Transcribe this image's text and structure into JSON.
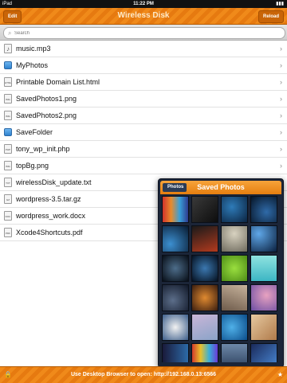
{
  "status_bar": {
    "carrier": "iPad",
    "time": "11:22 PM",
    "battery": "■■■"
  },
  "toolbar": {
    "title": "Wireless Disk",
    "edit_label": "Edit",
    "reload_label": "Reload"
  },
  "search": {
    "placeholder": "Search",
    "icon": "search-icon"
  },
  "files": [
    {
      "name": "music.mp3",
      "type": "audio",
      "badge": "♪"
    },
    {
      "name": "MyPhotos",
      "type": "folder",
      "badge": ""
    },
    {
      "name": "Printable Domain List.html",
      "type": "file",
      "badge": "HTML"
    },
    {
      "name": "SavedPhotos1.png",
      "type": "file",
      "badge": "IMG"
    },
    {
      "name": "SavedPhotos2.png",
      "type": "file",
      "badge": "IMG"
    },
    {
      "name": "SaveFolder",
      "type": "folder",
      "badge": ""
    },
    {
      "name": "tony_wp_init.php",
      "type": "file",
      "badge": "PHP"
    },
    {
      "name": "topBg.png",
      "type": "file",
      "badge": "IMG"
    },
    {
      "name": "wirelessDisk_update.txt",
      "type": "file",
      "badge": "TXT"
    },
    {
      "name": "wordpress-3.5.tar.gz",
      "type": "file",
      "badge": "GZ"
    },
    {
      "name": "wordpress_work.docx",
      "type": "file",
      "badge": "DOC"
    },
    {
      "name": "Xcode4Shortcuts.pdf",
      "type": "file",
      "badge": "PDF"
    }
  ],
  "popover": {
    "back_label": "Photos",
    "title": "Saved Photos",
    "thumbnails": [
      "linear-gradient(90deg,#d2332b,#e88b2c,#3aa0d8,#2d3b8f)",
      "linear-gradient(135deg,#3a3a3a,#0d0d0d)",
      "radial-gradient(circle at 40% 40%,#2e7bb8,#0b2340)",
      "radial-gradient(circle at 60% 60%,#2f6aa8,#061426)",
      "radial-gradient(circle at 30% 70%,#3c8fd0,#081a30)",
      "linear-gradient(160deg,#1a1a1a,#b33a1e)",
      "radial-gradient(circle at 50% 30%,#d8d2c0,#6e6a5d)",
      "radial-gradient(circle at 30% 30%,#5fa7e8,#0a1f3d)",
      "radial-gradient(circle at 50% 50%,#4d6d8a,#070d16)",
      "radial-gradient(circle at 50% 50%,#3b78b0,#05101f)",
      "radial-gradient(circle at 50% 50%,#9adf3f,#4d8c16)",
      "linear-gradient(180deg,#8fe3e0,#3cb6c4)",
      "radial-gradient(circle at 40% 60%,#5c6e8a,#0f1626)",
      "radial-gradient(circle at 50% 50%,#e08a30,#3a1d0f)",
      "linear-gradient(200deg,#c7b39c,#6d5a4a)",
      "radial-gradient(circle at 60% 40%,#e8a2c0,#6b4da3)",
      "radial-gradient(circle at 50% 50%,#f2f2f2,#3b5d8a)",
      "linear-gradient(160deg,#c9b6d8,#8aa3c8)",
      "radial-gradient(circle at 40% 50%,#4fb0e8,#0b4c8a)",
      "linear-gradient(135deg,#e6c9a0,#b07a4a)",
      "linear-gradient(90deg,#1a1a3a,#2c6aa8)",
      "linear-gradient(90deg,#d23a2c,#e8c02c,#3ab0d8,#6a3ad8)",
      "linear-gradient(180deg,#6d88a8,#2a3d5a)",
      "linear-gradient(135deg,#1a2a5a,#4a8ad8)"
    ]
  },
  "bottom_bar": {
    "message": "Use Desktop Browser to open: http://192.168.0.13:6566",
    "lock_icon": "lock-icon",
    "star_icon": "star-icon"
  }
}
